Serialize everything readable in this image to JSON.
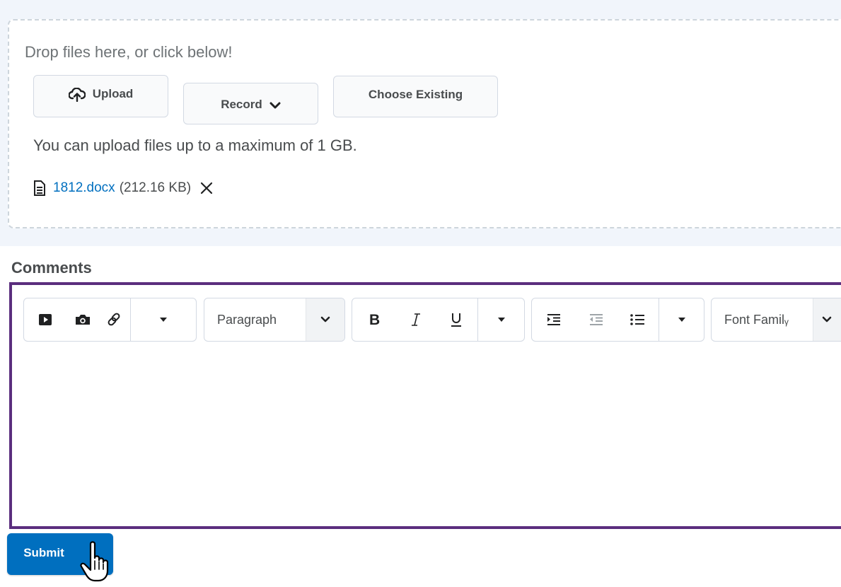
{
  "upload": {
    "drop_hint": "Drop files here, or click below!",
    "upload_label": "Upload",
    "record_label": "Record",
    "choose_existing_label": "Choose Existing",
    "limit_text": "You can upload files up to a maximum of 1 GB.",
    "file": {
      "name": "1812.docx",
      "size": "(212.16 KB)"
    }
  },
  "comments": {
    "label": "Comments",
    "format_select": "Paragraph",
    "font_family_select": "Font Familᵧ"
  },
  "submit": {
    "label": "Submit"
  },
  "colors": {
    "accent": "#006fbf",
    "editor_focus_border": "#5b2e7e",
    "drop_zone_background": "#f1f5fb",
    "dashed_border": "#cdd5dc"
  },
  "icons": {
    "upload": "upload-icon",
    "record_dropdown": "chevron-down-icon",
    "file": "document-icon",
    "remove": "close-icon",
    "video": "video-play-icon",
    "camera": "camera-icon",
    "link": "link-icon",
    "more": "caret-down-icon",
    "bold": "bold-icon",
    "italic": "italic-icon",
    "underline": "underline-icon",
    "indent": "indent-icon",
    "outdent": "outdent-icon",
    "bullet_list": "bullet-list-icon",
    "cursor": "hand-pointer-icon"
  }
}
